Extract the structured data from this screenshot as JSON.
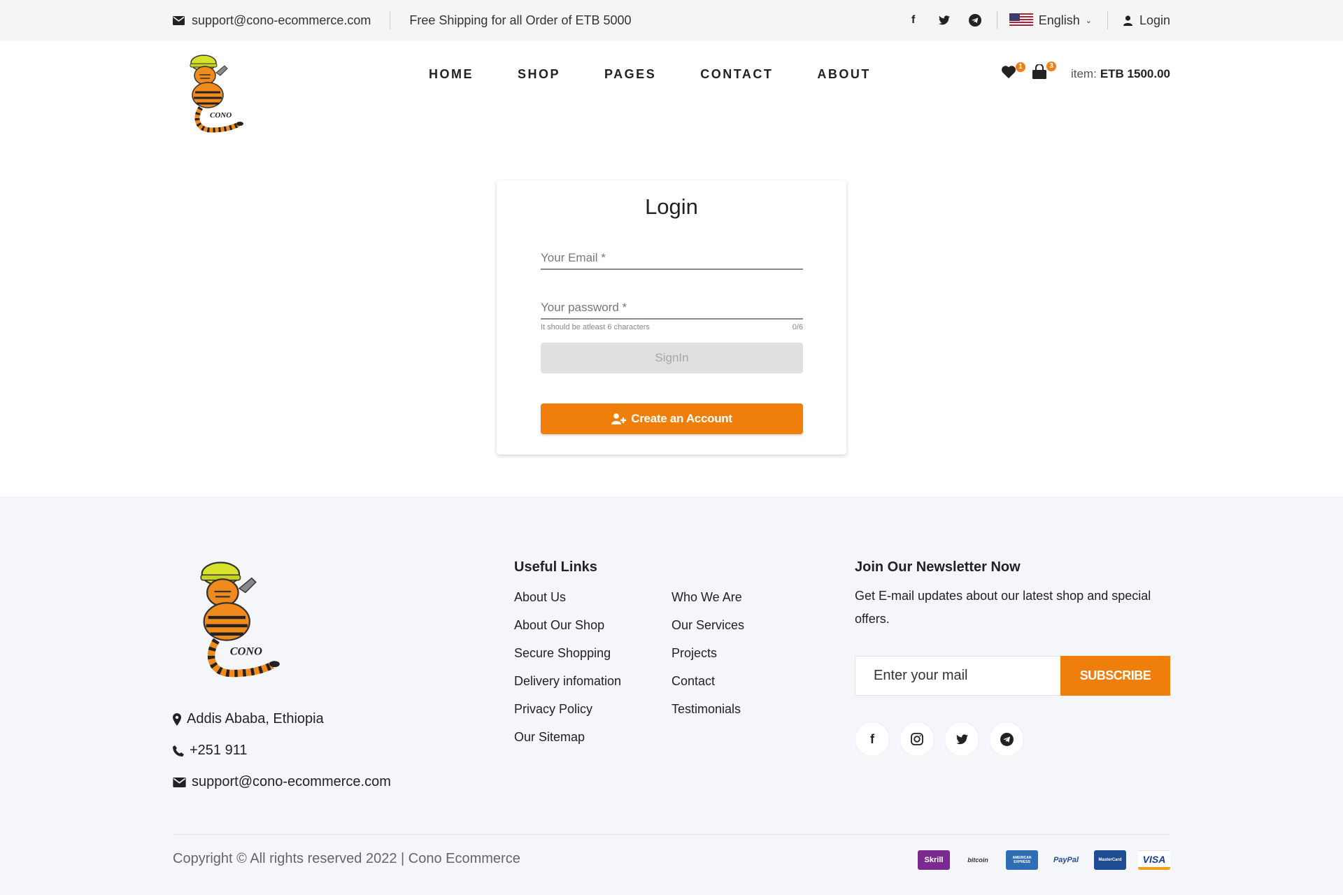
{
  "topbar": {
    "email": "support@cono-ecommerce.com",
    "shipping": "Free Shipping for all Order of ETB 5000",
    "language": "English",
    "login": "Login"
  },
  "nav": {
    "items": [
      "HOME",
      "SHOP",
      "PAGES",
      "CONTACT",
      "ABOUT"
    ]
  },
  "cart": {
    "wishlist_count": "1",
    "cart_count": "3",
    "item_label": "item:",
    "item_value": "ETB 1500.00"
  },
  "login_form": {
    "title": "Login",
    "email_placeholder": "Your Email *",
    "password_placeholder": "Your password *",
    "password_hint": "It should be atleast 6 characters",
    "password_counter": "0/6",
    "signin_label": "SignIn",
    "create_account_label": "Create an Account"
  },
  "footer": {
    "logo_text": "CONO",
    "address": "Addis Ababa, Ethiopia",
    "phone": "+251 911",
    "email": "support@cono-ecommerce.com",
    "useful_links_title": "Useful Links",
    "links_col1": [
      "About Us",
      "About Our Shop",
      "Secure Shopping",
      "Delivery infomation",
      "Privacy Policy",
      "Our Sitemap"
    ],
    "links_col2": [
      "Who We Are",
      "Our Services",
      "Projects",
      "Contact",
      "Testimonials"
    ],
    "newsletter_title": "Join Our Newsletter Now",
    "newsletter_text": "Get E-mail updates about our latest shop and special offers.",
    "newsletter_placeholder": "Enter your mail",
    "subscribe_label": "SUBSCRIBE",
    "copyright": "Copyright © All rights reserved 2022 | Cono Ecommerce",
    "payments": [
      "Skrill",
      "bitcoin",
      "AMERICAN EXPRESS",
      "PayPal",
      "MasterCard",
      "VISA"
    ]
  },
  "colors": {
    "accent": "#ef7f0a",
    "topbar_bg": "#f5f5f5",
    "footer_bg": "#f4f6fa"
  },
  "icons": [
    "envelope-icon",
    "facebook-icon",
    "twitter-icon",
    "telegram-icon",
    "user-icon",
    "heart-icon",
    "shopping-bag-icon",
    "user-plus-icon",
    "map-marker-icon",
    "phone-icon",
    "instagram-icon"
  ]
}
